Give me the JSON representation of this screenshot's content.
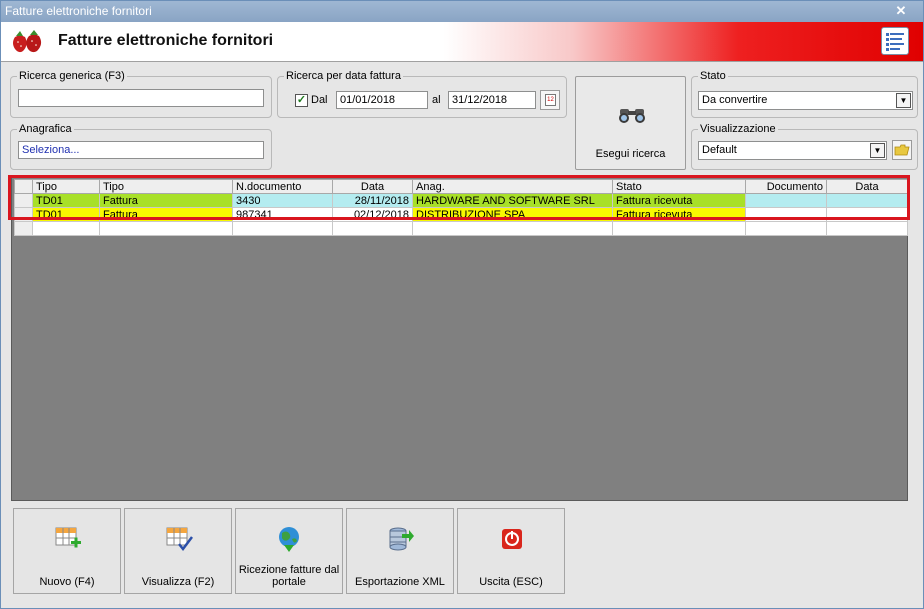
{
  "window": {
    "title": "Fatture elettroniche fornitori",
    "close_glyph": "✕"
  },
  "header": {
    "title": "Fatture elettroniche fornitori",
    "logo_icon": "strawberry-icon",
    "menu_icon": "document-list-icon"
  },
  "search": {
    "generic_label": "Ricerca generica (F3)",
    "generic_value": "",
    "anagrafica_label": "Anagrafica",
    "anagrafica_value": "Seleziona...",
    "date_group_label": "Ricerca per data fattura",
    "dal_label": "Dal",
    "dal_checked": true,
    "date_from": "01/01/2018",
    "al_label": "al",
    "date_to": "31/12/2018",
    "execute_label": "Esegui ricerca"
  },
  "stato": {
    "label": "Stato",
    "selected": "Da convertire"
  },
  "visualizzazione": {
    "label": "Visualizzazione",
    "selected": "Default"
  },
  "grid": {
    "columns": [
      "Tipo",
      "Tipo",
      "N.documento",
      "Data",
      "Anag.",
      "Stato",
      "Documento",
      "Data"
    ],
    "rows": [
      {
        "c0": "TD01",
        "c1": "Fattura",
        "c2": "3430",
        "c3": "28/11/2018",
        "c4": "HARDWARE AND SOFTWARE SRL",
        "c5": "Fattura ricevuta",
        "c6": "",
        "c7": ""
      },
      {
        "c0": "TD01",
        "c1": "Fattura",
        "c2": "987341",
        "c3": "02/12/2018",
        "c4": "DISTRIBUZIONE SPA",
        "c5": "Fattura ricevuta",
        "c6": "",
        "c7": ""
      }
    ],
    "colors": {
      "green": "#a8e028",
      "cyan": "#b4ecf0",
      "yellow": "#f8f800",
      "highlight": "#d9161f"
    }
  },
  "toolbar": {
    "new_label": "Nuovo (F4)",
    "view_label": "Visualizza (F2)",
    "receive_label_1": "Ricezione fatture dal",
    "receive_label_2": "portale",
    "export_label": "Esportazione XML",
    "exit_label": "Uscita (ESC)"
  }
}
